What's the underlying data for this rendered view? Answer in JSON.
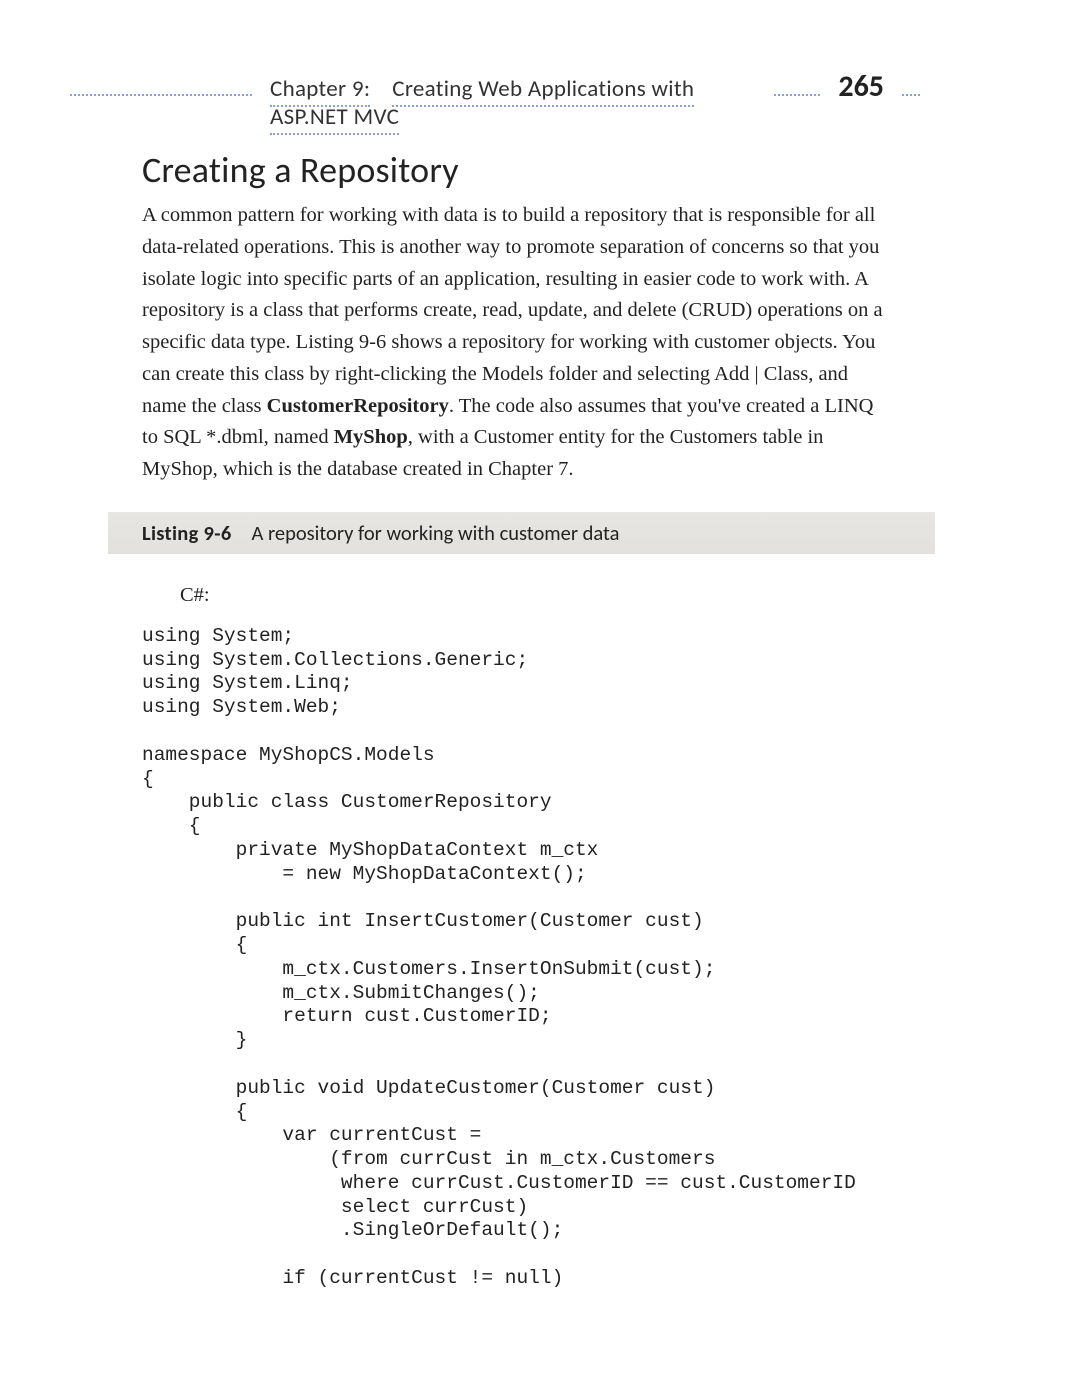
{
  "header": {
    "chapter_prefix": "Chapter 9:",
    "chapter_title": "Creating Web Applications with ASP.NET MVC",
    "page_number": "265"
  },
  "section": {
    "title": "Creating a Repository",
    "paragraph_parts": {
      "p1a": "A common pattern for working with data is to build a repository that is responsible for all data-related operations. This is another way to promote separation of concerns so that you isolate logic into specific parts of an application, resulting in easier code to work with. A repository is a class that performs create, read, update, and delete (CRUD) operations on a specific data type. Listing 9-6 shows a repository for working with customer objects. You can create this class by right-clicking the Models folder and selecting Add | Class, and name the class ",
      "p1_bold1": "CustomerRepository",
      "p1b": ". The code also assumes that you've created a LINQ to SQL *.dbml, named ",
      "p1_bold2": "MyShop",
      "p1c": ", with a Customer entity for the Customers table in MyShop, which is the database created in Chapter 7."
    }
  },
  "listing": {
    "label": "Listing 9-6",
    "title": "A repository for working with customer data"
  },
  "code": {
    "language": "C#:",
    "body": "using System;\nusing System.Collections.Generic;\nusing System.Linq;\nusing System.Web;\n\nnamespace MyShopCS.Models\n{\n    public class CustomerRepository\n    {\n        private MyShopDataContext m_ctx\n            = new MyShopDataContext();\n\n        public int InsertCustomer(Customer cust)\n        {\n            m_ctx.Customers.InsertOnSubmit(cust);\n            m_ctx.SubmitChanges();\n            return cust.CustomerID;\n        }\n\n        public void UpdateCustomer(Customer cust)\n        {\n            var currentCust =\n                (from currCust in m_ctx.Customers\n                 where currCust.CustomerID == cust.CustomerID\n                 select currCust)\n                 .SingleOrDefault();\n\n            if (currentCust != null)"
  }
}
